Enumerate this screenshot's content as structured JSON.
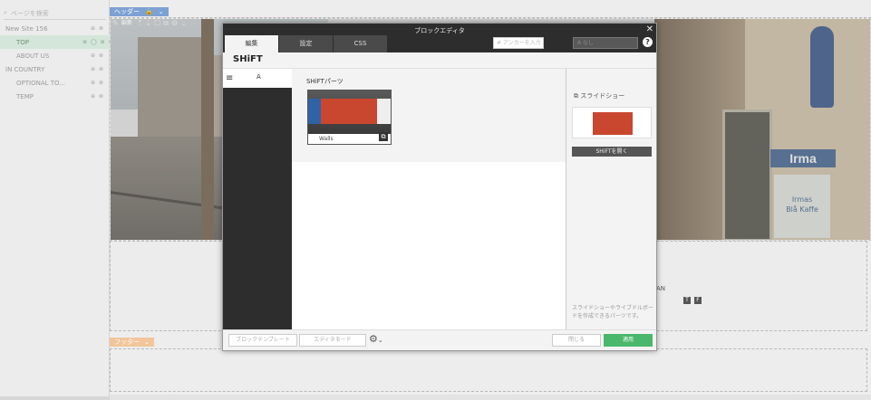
{
  "tree": {
    "search_placeholder": "ページを検索",
    "items": [
      {
        "label": "New Site 156",
        "icons": "⊕ ⊗",
        "indent": false,
        "selected": false
      },
      {
        "label": "TOP",
        "icons": "⊕ ◯ ⊕ ⊗",
        "indent": true,
        "selected": true
      },
      {
        "label": "ABOUT US",
        "icons": "⊕ ⊗",
        "indent": true,
        "selected": false
      },
      {
        "label": "IN COUNTRY",
        "icons": "⊕ ⊗",
        "indent": false,
        "selected": false
      },
      {
        "label": "OPTIONAL TO...",
        "icons": "⊕ ⊗",
        "indent": true,
        "selected": false
      },
      {
        "label": "TEMP",
        "icons": "⊕ ⊗",
        "indent": true,
        "selected": false
      }
    ]
  },
  "page": {
    "header_tag": "ヘッダー",
    "footer_tag": "フッター",
    "section_text": "AN",
    "social": [
      "T",
      "F"
    ]
  },
  "photo": {
    "irma_text": "Irma",
    "sign_line1": "Irmas",
    "sign_line2": "Blå Kaffe"
  },
  "dialog": {
    "title": "ブロックエディタ",
    "tabs": [
      "編集",
      "設定",
      "CSS"
    ],
    "anchor_placeholder": "# アンカーを入力",
    "select_value": "A なし",
    "category": "SHiFT",
    "left_filter": "A",
    "section_title": "SHiFTパーツ",
    "card_label": "Walls",
    "right_title": "スライドショー",
    "right_button": "SHiFTを開く",
    "right_desc": "スライドショーやライブドルボードを作成できるパーツです。",
    "footer": {
      "template": "ブロックテンプレート",
      "mode": "エディタモード",
      "close": "閉じる",
      "apply": "適用"
    }
  }
}
